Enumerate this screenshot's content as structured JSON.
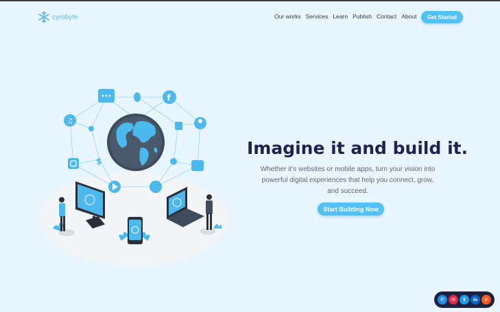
{
  "brand": {
    "name": "cyrobyte"
  },
  "nav": {
    "items": [
      {
        "label": "Our works"
      },
      {
        "label": "Services"
      },
      {
        "label": "Learn"
      },
      {
        "label": "Publish"
      },
      {
        "label": "Contact"
      },
      {
        "label": "About"
      }
    ],
    "cta_label": "Get Started"
  },
  "hero": {
    "title": "Imagine it and build it.",
    "description": "Whether it's websites or mobile apps, turn your vision into powerful digital experiences that help you connect, grow, and succeed.",
    "cta_label": "Start Building Now"
  },
  "social": {
    "items": [
      {
        "name": "phone-icon",
        "color": "#1e8ae8",
        "glyph": "✆"
      },
      {
        "name": "mail-icon",
        "color": "#e0284a",
        "glyph": "✉"
      },
      {
        "name": "twitter-icon",
        "color": "#1d9bf0",
        "glyph": "t"
      },
      {
        "name": "linkedin-icon",
        "color": "#0a66c2",
        "glyph": "in"
      },
      {
        "name": "reddit-icon",
        "color": "#ff5a1f",
        "glyph": "r"
      }
    ]
  },
  "colors": {
    "accent": "#52c1f5",
    "title": "#1f2150",
    "background": "#eaf6ff"
  }
}
